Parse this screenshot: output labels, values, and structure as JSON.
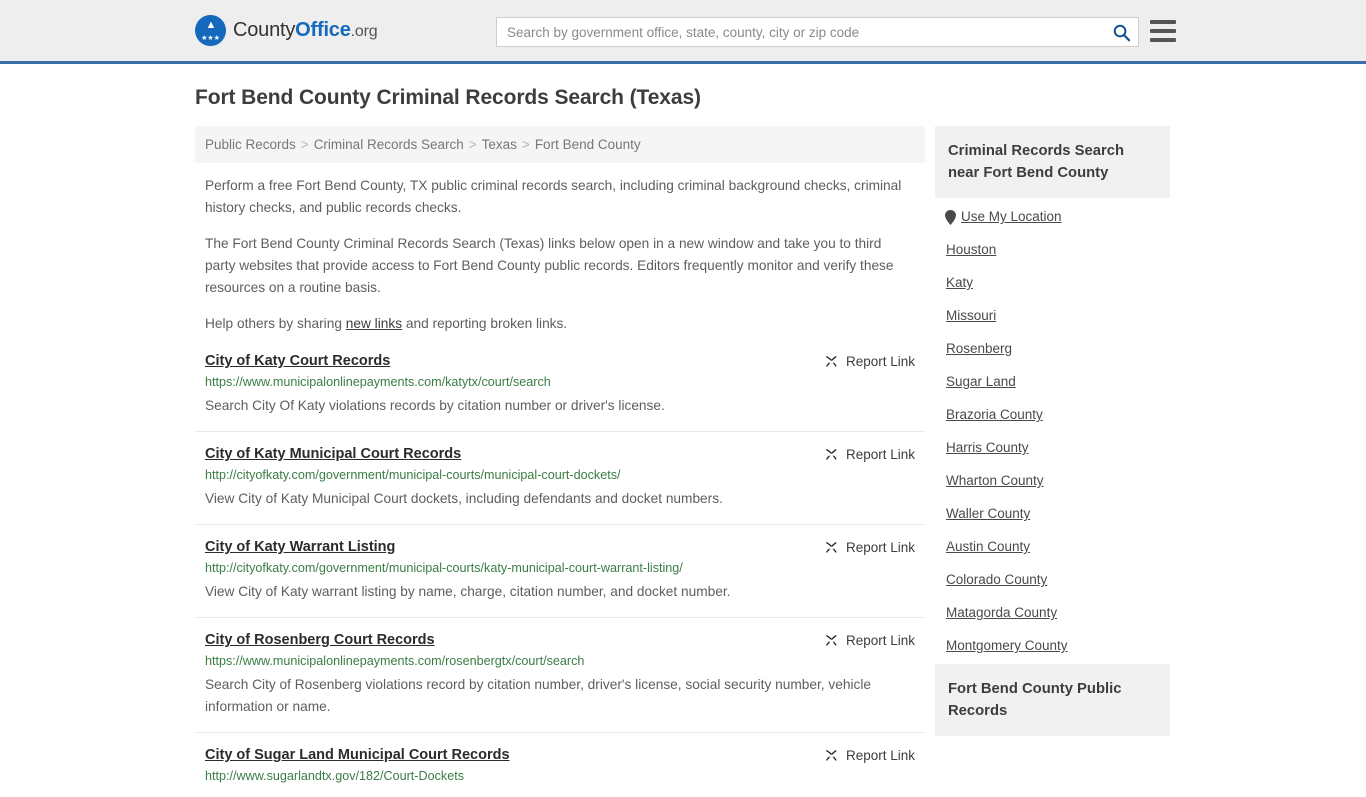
{
  "header": {
    "brand": {
      "part1": "County",
      "part2": "Office",
      "part3": ".org",
      "logo_icon": "eagle-shield-icon"
    },
    "search": {
      "placeholder": "Search by government office, state, county, city or zip code",
      "value": "",
      "search_icon": "search-icon"
    },
    "menu_icon": "hamburger-menu-icon",
    "accent_color": "#3a6ea5",
    "background_color": "#eeeeee"
  },
  "page_title": "Fort Bend County Criminal Records Search (Texas)",
  "breadcrumb": {
    "items": [
      {
        "label": "Public Records",
        "current": false
      },
      {
        "label": "Criminal Records Search",
        "current": false
      },
      {
        "label": "Texas",
        "current": false
      },
      {
        "label": "Fort Bend County",
        "current": true
      }
    ],
    "separator": ">"
  },
  "intro": {
    "paragraph1": "Perform a free Fort Bend County, TX public criminal records search, including criminal background checks, criminal history checks, and public records checks.",
    "paragraph2": "The Fort Bend County Criminal Records Search (Texas) links below open in a new window and take you to third party websites that provide access to Fort Bend County public records. Editors frequently monitor and verify these resources on a routine basis.",
    "paragraph3_before": "Help others by sharing ",
    "paragraph3_link": "new links",
    "paragraph3_after": " and reporting broken links."
  },
  "results": {
    "report_link_label": "Report Link",
    "report_link_icon": "broken-link-icon",
    "items": [
      {
        "title": "City of Katy Court Records",
        "url": "https://www.municipalonlinepayments.com/katytx/court/search",
        "description": "Search City Of Katy violations records by citation number or driver's license."
      },
      {
        "title": "City of Katy Municipal Court Records",
        "url": "http://cityofkaty.com/government/municipal-courts/municipal-court-dockets/",
        "description": "View City of Katy Municipal Court dockets, including defendants and docket numbers."
      },
      {
        "title": "City of Katy Warrant Listing",
        "url": "http://cityofkaty.com/government/municipal-courts/katy-municipal-court-warrant-listing/",
        "description": "View City of Katy warrant listing by name, charge, citation number, and docket number."
      },
      {
        "title": "City of Rosenberg Court Records",
        "url": "https://www.municipalonlinepayments.com/rosenbergtx/court/search",
        "description": "Search City of Rosenberg violations record by citation number, driver's license, social security number, vehicle information or name."
      },
      {
        "title": "City of Sugar Land Municipal Court Records",
        "url": "http://www.sugarlandtx.gov/182/Court-Dockets",
        "description": ""
      }
    ]
  },
  "sidebar": {
    "panel1": {
      "heading": "Criminal Records Search near Fort Bend County",
      "location_item": {
        "label": "Use My Location",
        "icon": "map-pin-icon"
      },
      "links": [
        "Houston",
        "Katy",
        "Missouri",
        "Rosenberg",
        "Sugar Land",
        "Brazoria County",
        "Harris County",
        "Wharton County",
        "Waller County",
        "Austin County",
        "Colorado County",
        "Matagorda County",
        "Montgomery County"
      ]
    },
    "panel2": {
      "heading": "Fort Bend County Public Records"
    }
  }
}
